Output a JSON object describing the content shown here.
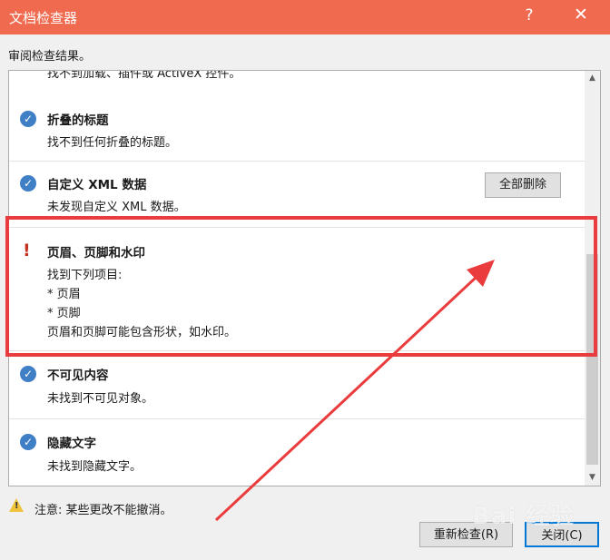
{
  "window": {
    "title": "文档检查器",
    "help": "?",
    "close": "✕"
  },
  "subtitle": "审阅检查结果。",
  "partial_text": "找不到加载、插件或 ActiveX 控件。",
  "sections": [
    {
      "title": "折叠的标题",
      "lines": [
        "找不到任何折叠的标题。"
      ],
      "status": "ok"
    },
    {
      "title": "自定义 XML 数据",
      "lines": [
        "未发现自定义 XML 数据。"
      ],
      "status": "ok"
    },
    {
      "title": "页眉、页脚和水印",
      "lines": [
        "找到下列项目:",
        "* 页眉",
        "* 页脚",
        "页眉和页脚可能包含形状，如水印。"
      ],
      "status": "warning",
      "action": "全部删除"
    },
    {
      "title": "不可见内容",
      "lines": [
        "未找到不可见对象。"
      ],
      "status": "ok"
    },
    {
      "title": "隐藏文字",
      "lines": [
        "未找到隐藏文字。"
      ],
      "status": "ok"
    }
  ],
  "note": "注意: 某些更改不能撤消。",
  "buttons": {
    "reinspect": "重新检查(R)",
    "close": "关闭(C)"
  },
  "watermark": "Bai 经验",
  "colors": {
    "titlebar": "#ef6a4e",
    "highlight": "#ea3c3c",
    "check": "#3f7fc6",
    "warning": "#c5311f"
  },
  "icons": {
    "check": "check-circle-icon",
    "warning": "exclamation-icon",
    "note": "warning-triangle-icon"
  }
}
